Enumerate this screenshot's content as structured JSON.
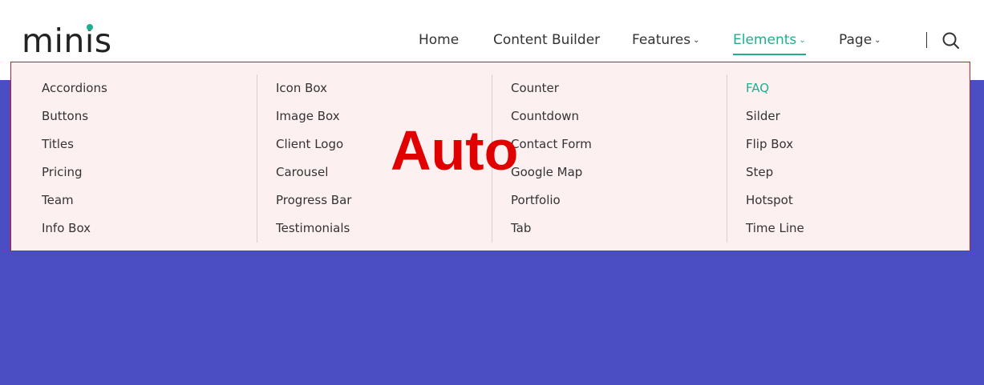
{
  "brand": {
    "logo_text_a": "min",
    "logo_text_i": "i",
    "logo_text_b": "s",
    "accent_color": "#1fae8f"
  },
  "nav": {
    "items": [
      {
        "label": "Home",
        "has_dropdown": false
      },
      {
        "label": "Content Builder",
        "has_dropdown": false
      },
      {
        "label": "Features",
        "has_dropdown": true
      },
      {
        "label": "Elements",
        "has_dropdown": true,
        "active": true
      },
      {
        "label": "Page",
        "has_dropdown": true
      }
    ],
    "search_icon": "search-icon"
  },
  "hero": {
    "background": "#4b4dc2"
  },
  "mega_menu": {
    "annotation_label": "Auto",
    "columns": [
      {
        "items": [
          "Accordions",
          "Buttons",
          "Titles",
          "Pricing",
          "Team",
          "Info Box"
        ]
      },
      {
        "items": [
          "Icon Box",
          "Image Box",
          "Client Logo",
          "Carousel",
          "Progress Bar",
          "Testimonials"
        ]
      },
      {
        "items": [
          "Counter",
          "Countdown",
          "Contact Form",
          "Google Map",
          "Portfolio",
          "Tab"
        ]
      },
      {
        "items": [
          "FAQ",
          "Silder",
          "Flip Box",
          "Step",
          "Hotspot",
          "Time Line"
        ],
        "active_index": 0
      }
    ]
  }
}
